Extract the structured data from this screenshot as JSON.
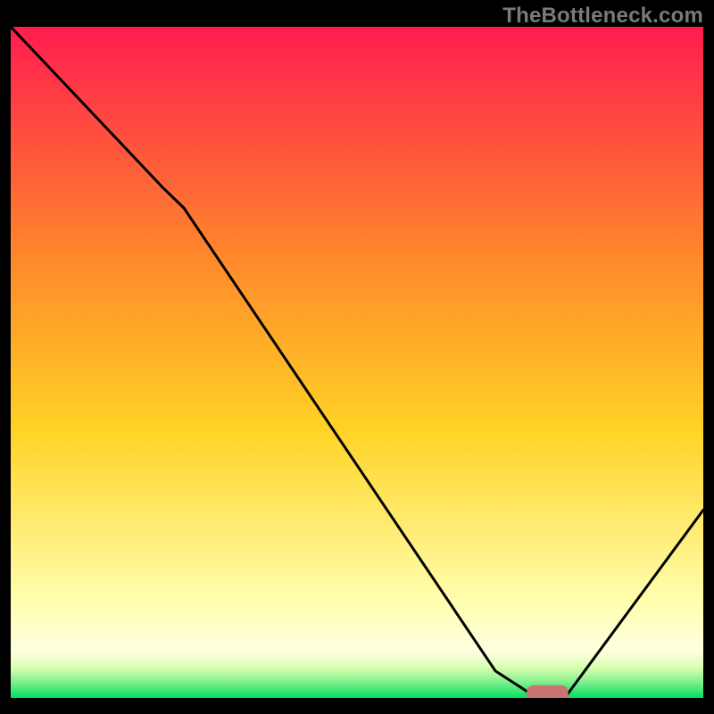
{
  "watermark": "TheBottleneck.com",
  "colors": {
    "gradient_top": "#ff1c4f",
    "gradient_mid_upper": "#ff8a2b",
    "gradient_mid": "#ffd325",
    "gradient_pale": "#ffffb0",
    "gradient_bottom": "#00e060",
    "curve": "#000000",
    "marker": "#cb7272",
    "background": "#000000"
  },
  "chart_data": {
    "type": "line",
    "title": "",
    "xlabel": "",
    "ylabel": "",
    "xlim": [
      0,
      100
    ],
    "ylim": [
      0,
      100
    ],
    "series": [
      {
        "name": "bottleneck-curve",
        "x": [
          0,
          22,
          25,
          70,
          76,
          80,
          100
        ],
        "values": [
          100,
          76,
          73,
          4,
          0,
          0,
          28
        ]
      }
    ],
    "marker": {
      "name": "optimal-range",
      "x_start": 74.5,
      "x_end": 80.5,
      "y": 0.5,
      "thickness": 2.8
    },
    "background_gradient_stops": [
      {
        "offset": 0.0,
        "color": "#ff1c4f"
      },
      {
        "offset": 0.35,
        "color": "#ff8a2b"
      },
      {
        "offset": 0.6,
        "color": "#ffd325"
      },
      {
        "offset": 0.86,
        "color": "#ffffb0"
      },
      {
        "offset": 0.93,
        "color": "#ffffe0"
      },
      {
        "offset": 0.955,
        "color": "#d8ffb0"
      },
      {
        "offset": 0.975,
        "color": "#88f090"
      },
      {
        "offset": 1.0,
        "color": "#00e060"
      }
    ]
  }
}
